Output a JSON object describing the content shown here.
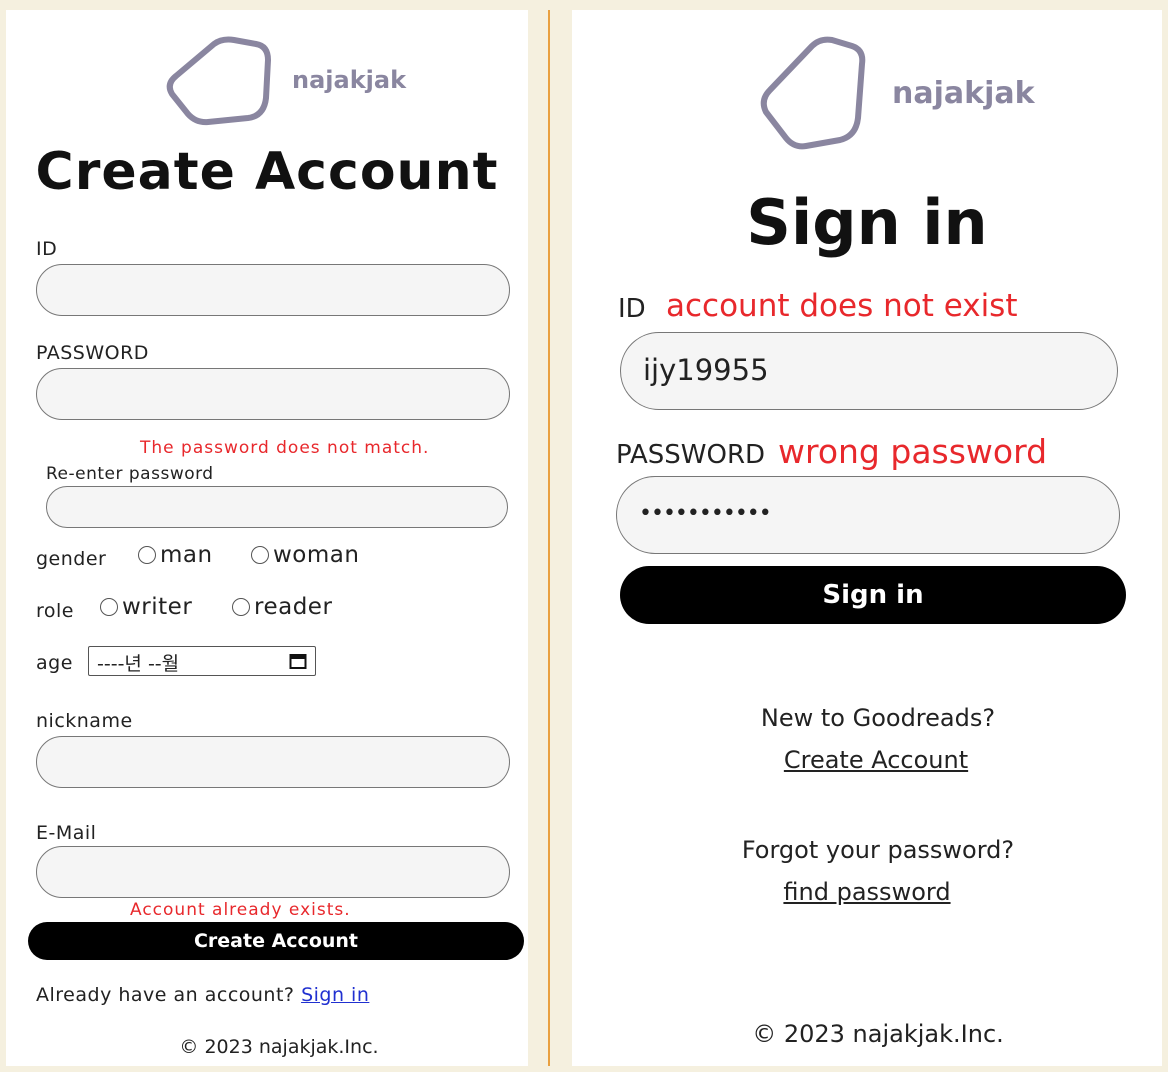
{
  "create": {
    "brand": "najakjak",
    "title": "Create Account",
    "id_label": "ID",
    "password_label": "PASSWORD",
    "password_error": "The password does not match.",
    "reenter_label": "Re-enter password",
    "gender_label": "gender",
    "gender_options": [
      "man",
      "woman"
    ],
    "role_label": "role",
    "role_options": [
      "writer",
      "reader"
    ],
    "age_label": "age",
    "age_value": "----년 --월",
    "nickname_label": "nickname",
    "email_label": "E-Mail",
    "email_error": "Account already exists.",
    "submit_label": "Create Account",
    "already_text": "Already have an account?",
    "signin_link": "Sign in",
    "footer": "© 2023 najakjak.Inc."
  },
  "signin": {
    "brand": "najakjak",
    "title": "Sign in",
    "id_label": "ID",
    "id_error": "account does not exist",
    "id_value": "ijy19955",
    "password_label": "PASSWORD",
    "password_error": "wrong password",
    "password_value": "•••••••••••",
    "submit_label": "Sign in",
    "new_text": "New to Goodreads?",
    "create_link": "Create Account",
    "forgot_text": "Forgot your password?",
    "find_link": "find password",
    "footer": "© 2023 najakjak.Inc."
  },
  "colors": {
    "background": "#f5f0df",
    "error": "#e8282c",
    "divider": "#e9a040",
    "logo": "#8a86a0",
    "link": "#2030d0"
  }
}
